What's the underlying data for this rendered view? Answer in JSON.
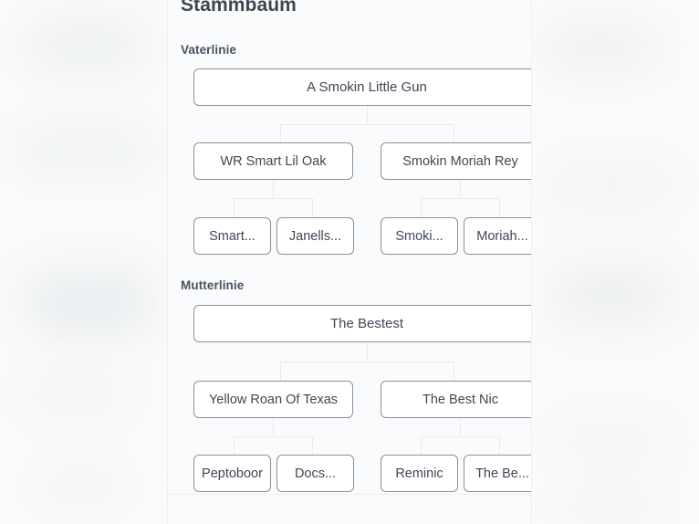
{
  "card": {
    "title": "Stammbaum"
  },
  "sections": [
    {
      "label": "Vaterlinie",
      "root": {
        "label": "A Smokin Little Gun"
      },
      "mid": [
        {
          "label": "WR Smart Lil Oak"
        },
        {
          "label": "Smokin Moriah Rey"
        }
      ],
      "leaves": [
        {
          "label": "Smart..."
        },
        {
          "label": "Janells..."
        },
        {
          "label": "Smoki..."
        },
        {
          "label": "Moriah..."
        }
      ]
    },
    {
      "label": "Mutterlinie",
      "root": {
        "label": "The Bestest"
      },
      "mid": [
        {
          "label": "Yellow Roan Of Texas"
        },
        {
          "label": "The Best Nic"
        }
      ],
      "leaves": [
        {
          "label": "Peptoboor"
        },
        {
          "label": "Docs..."
        },
        {
          "label": "Reminic"
        },
        {
          "label": "The Be..."
        }
      ]
    }
  ],
  "colors": {
    "page_background": "#fafbfb",
    "card_background": "#fafbfc",
    "node_border": "#8b9199",
    "node_fill": "#ffffff",
    "text_primary": "#3f4854",
    "heading": "#3e4652",
    "connector": "#e9ebee"
  }
}
